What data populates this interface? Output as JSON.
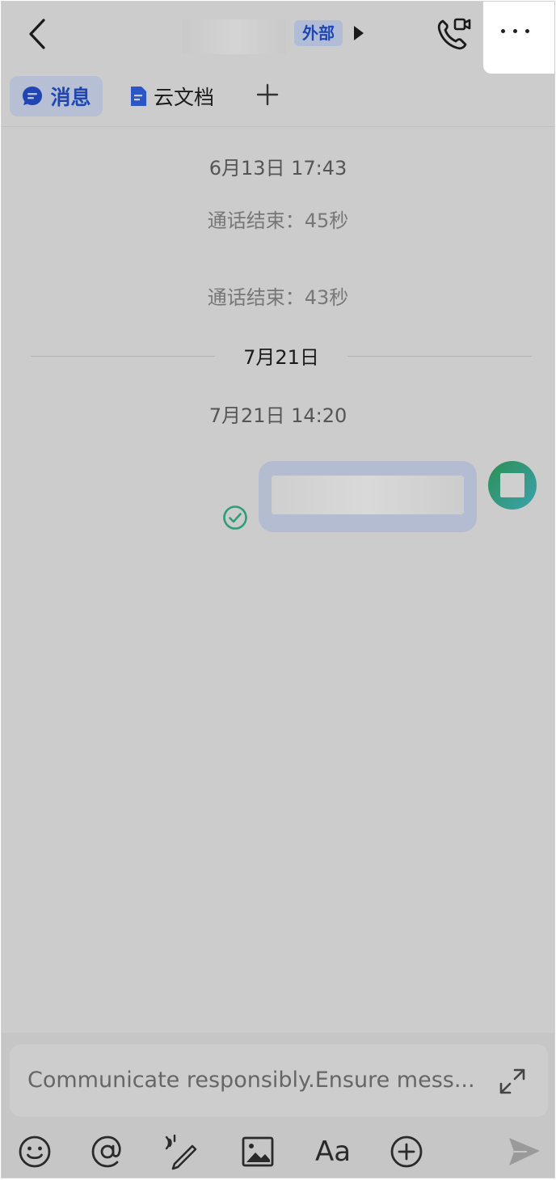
{
  "header": {
    "badge": "外部",
    "icons": [
      "back-arrow-icon",
      "video-call-icon",
      "more-icon"
    ]
  },
  "tabs": {
    "messages": "消息",
    "docs": "云文档",
    "add": "+"
  },
  "chat": {
    "timestamp1": "6月13日 17:43",
    "call1": "通话结束：45秒",
    "call2": "通话结束：43秒",
    "date_divider": "7月21日",
    "timestamp2": "7月21日 14:20"
  },
  "composer": {
    "placeholder": "Communicate responsibly.Ensure mess...",
    "tools": [
      "emoji-icon",
      "mention-icon",
      "voice-pen-icon",
      "image-icon",
      "text-format-icon",
      "add-icon",
      "send-icon"
    ],
    "font_tool_label": "Aa"
  },
  "colors": {
    "accent": "#1f46b3",
    "read_check": "#2f9e78",
    "background": "#cccccc"
  }
}
